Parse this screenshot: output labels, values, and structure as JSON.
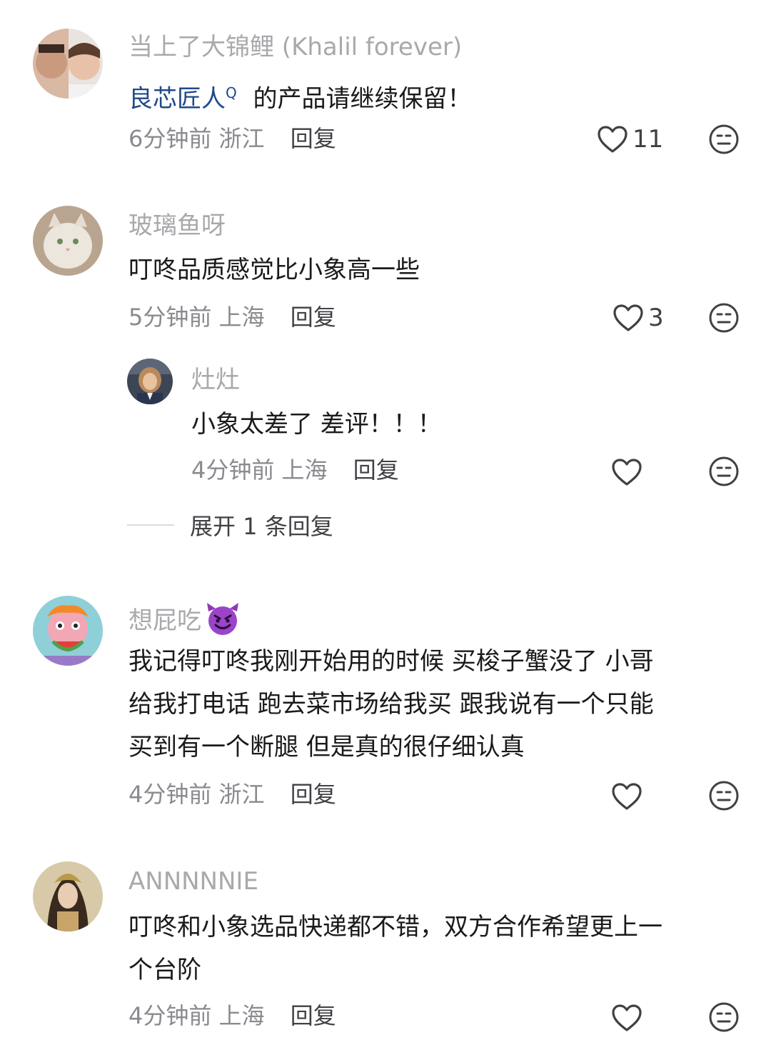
{
  "comments": [
    {
      "username": "当上了大锦鲤 (Khalil forever)",
      "mention": "良芯匠人",
      "mention_mark": "Q",
      "text": " 的产品请继续保留！",
      "time": "6分钟前",
      "location": "浙江",
      "reply_label": "回复",
      "likes": "11"
    },
    {
      "username": "玻璃鱼呀",
      "text": "叮咚品质感觉比小象高一些",
      "time": "5分钟前",
      "location": "上海",
      "reply_label": "回复",
      "likes": "3"
    },
    {
      "username": "想屁吃",
      "username_emoji": "smiling-devil-icon",
      "text_lines": [
        "我记得叮咚我刚开始用的时候 买梭子蟹没了 小哥",
        "给我打电话 跑去菜市场给我买 跟我说有一个只能",
        "买到有一个断腿  但是真的很仔细认真"
      ],
      "time": "4分钟前",
      "location": "浙江",
      "reply_label": "回复",
      "likes": ""
    },
    {
      "username": "ANNNNNIE",
      "text_lines": [
        "叮咚和小象选品快递都不错，双方合作希望更上一",
        "个台阶"
      ],
      "time": "4分钟前",
      "location": "上海",
      "reply_label": "回复",
      "likes": ""
    }
  ],
  "reply": {
    "username": "灶灶",
    "text": "小象太差了 差评！！！",
    "time": "4分钟前",
    "location": "上海",
    "reply_label": "回复",
    "likes": ""
  },
  "expand_label": "展开 1 条回复",
  "icons": {
    "like": "heart-outline-icon",
    "dislike": "neutral-face-icon"
  }
}
